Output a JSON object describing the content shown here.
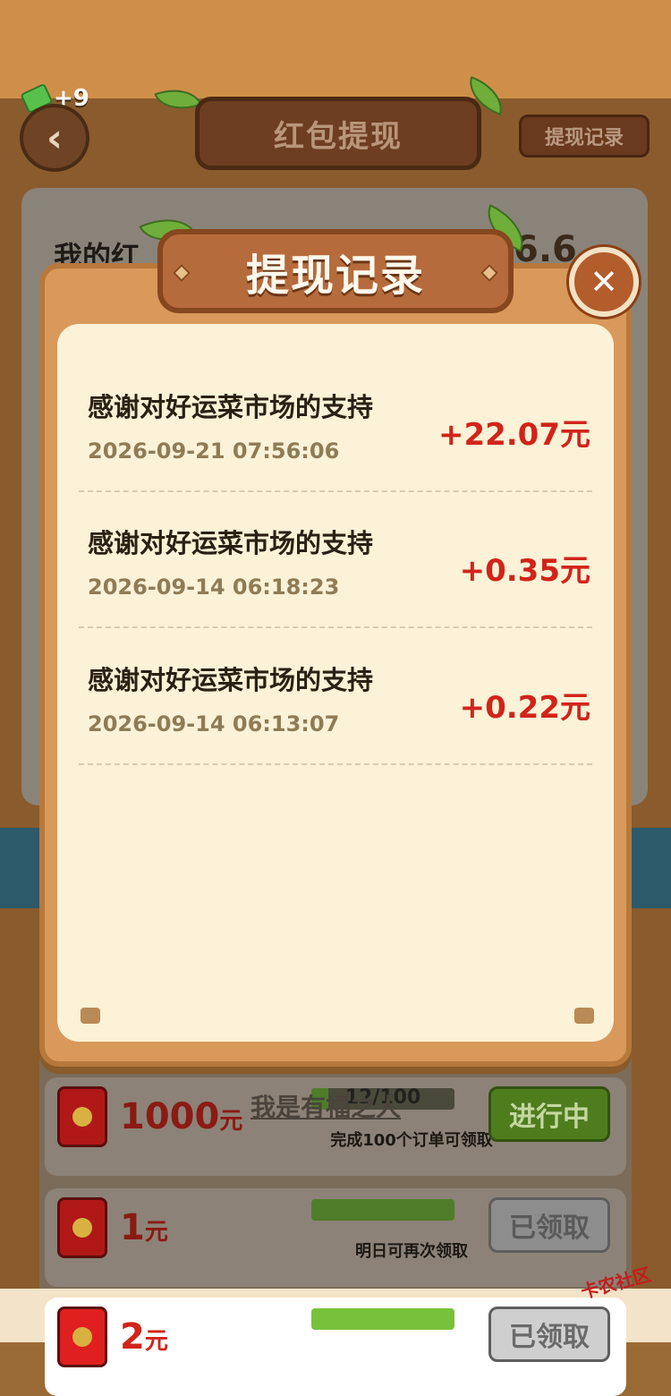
{
  "header": {
    "currency_amount": "+9",
    "back_icon": "chevron-left-icon",
    "title": "红包提现",
    "records_button_label": "提现记录"
  },
  "balance_card": {
    "label": "我的红",
    "value": "6.6"
  },
  "tasks": [
    {
      "amount": "1000",
      "unit": "元",
      "progress_text": "12/100",
      "progress_fraction": 0.12,
      "hint": "完成100个订单可领取",
      "button": "进行中",
      "overlay_text": "我是有福之人"
    },
    {
      "amount": "1",
      "unit": "元",
      "progress_fraction": 1,
      "hint": "明日可再次领取",
      "button": "已领取"
    },
    {
      "amount": "2",
      "unit": "元",
      "progress_fraction": 1,
      "button": "已领取"
    }
  ],
  "modal": {
    "title": "提现记录",
    "close_icon": "close-icon",
    "records": [
      {
        "desc": "感谢对好运菜市场的支持",
        "time": "2026-09-21 07:56:06",
        "amount": "+22.07元"
      },
      {
        "desc": "感谢对好运菜市场的支持",
        "time": "2026-09-14 06:18:23",
        "amount": "+0.35元"
      },
      {
        "desc": "感谢对好运菜市场的支持",
        "time": "2026-09-14 06:13:07",
        "amount": "+0.22元"
      }
    ]
  },
  "watermark": "卡农社区",
  "colors": {
    "amount_red": "#d1241a",
    "modal_wood": "#d8995a",
    "modal_paper": "#fbf2d7",
    "title_plaque": "#b66b3c"
  }
}
